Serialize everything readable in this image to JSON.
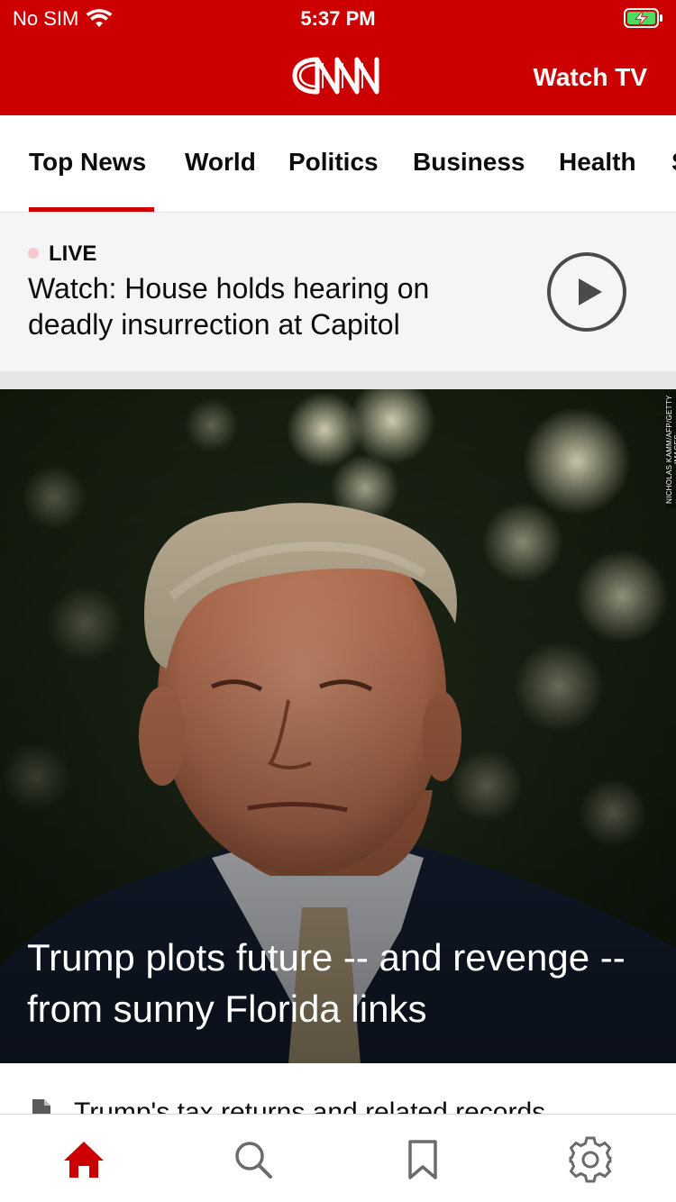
{
  "status_bar": {
    "carrier": "No SIM",
    "time": "5:37 PM",
    "icons": [
      "wifi-icon",
      "battery-charging-icon"
    ]
  },
  "header": {
    "logo": "CNN",
    "watch_tv_label": "Watch TV",
    "accent_color": "#cc0000"
  },
  "tabs": [
    {
      "label": "Top News",
      "active": true
    },
    {
      "label": "World"
    },
    {
      "label": "Politics"
    },
    {
      "label": "Business"
    },
    {
      "label": "Health"
    },
    {
      "label": "S"
    }
  ],
  "live": {
    "badge": "LIVE",
    "headline": "Watch: House holds hearing on deadly insurrection at Capitol",
    "icon": "play-circle-icon"
  },
  "hero": {
    "photo_credit": "NICHOLAS KAMM/AFP/GETTY IMAGES",
    "headline": "Trump plots future -- and revenge -- from sunny Florida links"
  },
  "next_story": {
    "icon": "document-icon",
    "headline": "Trump's tax returns and related records"
  },
  "bottom_nav": {
    "items": [
      "home-icon",
      "search-icon",
      "bookmark-icon",
      "settings-gear-icon"
    ],
    "active": "home-icon"
  }
}
